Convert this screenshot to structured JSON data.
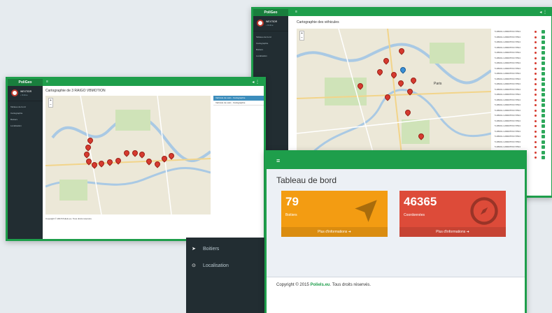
{
  "brand": "PoliGeo",
  "user": {
    "name": "WEXTIDR",
    "status": "• Online"
  },
  "sidebar_items": [
    "Tableau de bord",
    "Cartographie",
    "Boitiers",
    "Localisation"
  ],
  "window1": {
    "title": "Cartographie de 3 RAIGO VBMOTION",
    "list": [
      "Vehicule de suivi - Cartographie",
      "Vehicule de suivi - Cartographie"
    ],
    "footer": "Copyright © 2015 Poliels.eu. Tous droits réservés."
  },
  "window2": {
    "title": "Cartographie des véhicules",
    "vehicles": [
      "5 AB001-CAB005703 /5534",
      "5 AB001-CAB005703 /5534",
      "5 AB001-CAB005703 /5534",
      "5 AB001-CAB005703 /5534",
      "5 AB001-CAB005703 /5534",
      "5 AB001-CAB005703 /5534",
      "5 AB001-CAB005703 /5534",
      "5 AB001-CAB005703 /5534",
      "5 AB001-CAB005703 /5534",
      "5 AB001-CAB005703 /5534",
      "5 AB001-CAB005703 /5534",
      "5 AB001-CAB005703 /5534",
      "5 AB001-CAB005703 /5534",
      "5 AB001-CAB005703 /5534",
      "5 AB001-CAB005703 /5534",
      "5 AB001-CAB005703 /5534",
      "5 AB001-CAB005703 /5534",
      "5 AB001-CAB005703 /5534",
      "5 AB001-CAB005703 /5534",
      "5 AB001-CAB005703 /5534",
      "5 AB001-CAB005703 /5534",
      "5 AB001-CAB005703 /5534",
      "5 AB001-CAB005703 /5534",
      "5 AB001-CAB005703 /5534",
      "5 AB001-CAB005703 /5534"
    ],
    "city": "Paris"
  },
  "dashboard": {
    "menu_icon": "≡",
    "title": "Tableau de bord",
    "boxes": [
      {
        "value": "79",
        "label": "Boitiers",
        "footer": "Plus d'informations ➜",
        "color": "#f39c12",
        "footer_color": "#da8c10",
        "icon": "location-arrow-icon"
      },
      {
        "value": "46365",
        "label": "Coordonnées",
        "footer": "Plus d'informations ➜",
        "color": "#dd4b39",
        "footer_color": "#c64333",
        "icon": "compass-icon"
      }
    ],
    "copyright_prefix": "Copyright © 2015 ",
    "copyright_brand": "Poliels.eu",
    "copyright_suffix": ". Tous droits réservés."
  },
  "dark_panel": {
    "items": [
      {
        "icon": "➤",
        "label": "Boitiers"
      },
      {
        "icon": "⊙",
        "label": "Localisation"
      }
    ]
  },
  "colors": {
    "green": "#1e9e4b",
    "dark": "#222d32"
  }
}
